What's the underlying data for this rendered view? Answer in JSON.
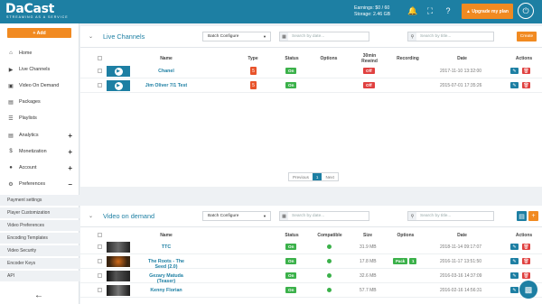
{
  "topbar": {
    "logo": "DaCast",
    "logo_sub": "STREAMING AS A SERVICE",
    "earnings": "Earnings: $0 / 60",
    "storage": "Storage: 2.46 GB",
    "bell_icon": "bell-icon",
    "expand_icon": "expand-icon",
    "help_icon": "question-icon",
    "upgrade_label": "Upgrade my plan",
    "colors": {
      "bar": "#1d7fa3",
      "accent": "#f18a21"
    }
  },
  "sidebar": {
    "add_label": "+ Add",
    "items": [
      {
        "label": "Home",
        "icon": "home-icon"
      },
      {
        "label": "Live Channels",
        "icon": "play-icon"
      },
      {
        "label": "Video On Demand",
        "icon": "video-icon"
      },
      {
        "label": "Packages",
        "icon": "folder-icon"
      },
      {
        "label": "Playlists",
        "icon": "list-icon"
      },
      {
        "label": "Analytics",
        "icon": "chart-icon"
      },
      {
        "label": "Monetization",
        "icon": "dollar-icon"
      },
      {
        "label": "Account",
        "icon": "user-icon"
      },
      {
        "label": "Preferences",
        "icon": "gear-icon"
      }
    ],
    "subitems": [
      "Payment settings",
      "Player Customization",
      "Video Preferences",
      "Encoding Templates",
      "Video Security",
      "Encoder Keys",
      "API"
    ]
  },
  "live": {
    "title": "Live Channels",
    "batch": "Batch Configure",
    "search_date": "Search by date...",
    "search_title": "Search by title...",
    "create": "Create",
    "columns": [
      "Name",
      "Type",
      "Status",
      "Options",
      "30min Rewind",
      "Recording",
      "Date",
      "Actions"
    ],
    "rows": [
      {
        "name": "Chanel",
        "status": "On",
        "rewind": "Off",
        "date": "2017-11-10 13:32:00"
      },
      {
        "name": "Jim Oliver 7/1 Test",
        "status": "On",
        "rewind": "Off",
        "date": "2015-07-01 17:35:26"
      }
    ],
    "pager": {
      "prev": "Previous",
      "page": "1",
      "next": "Next"
    }
  },
  "vod": {
    "title": "Video on demand",
    "batch": "Batch Configure",
    "search_date": "Search by date...",
    "search_title": "Search by title...",
    "columns": [
      "Name",
      "Status",
      "Compatible",
      "Size",
      "Options",
      "Date",
      "Actions"
    ],
    "rows": [
      {
        "name": "TTC",
        "status": "On",
        "size": "31.9 MB",
        "pack": "",
        "date": "2018-11-14 09:17:07"
      },
      {
        "name": "The Roots - The Seed (2.0)",
        "status": "On",
        "size": "17.8 MB",
        "pack": "Pack",
        "pack_count": "1",
        "date": "2016-11-17 13:51:50"
      },
      {
        "name": "Gezary Matuda (Teaser)",
        "status": "On",
        "size": "32.6 MB",
        "pack": "",
        "date": "2016-03-16 14:37:09"
      },
      {
        "name": "Kenny Florian",
        "status": "On",
        "size": "57.7 MB",
        "pack": "",
        "date": "2016-02-16 14:56:31"
      }
    ]
  }
}
